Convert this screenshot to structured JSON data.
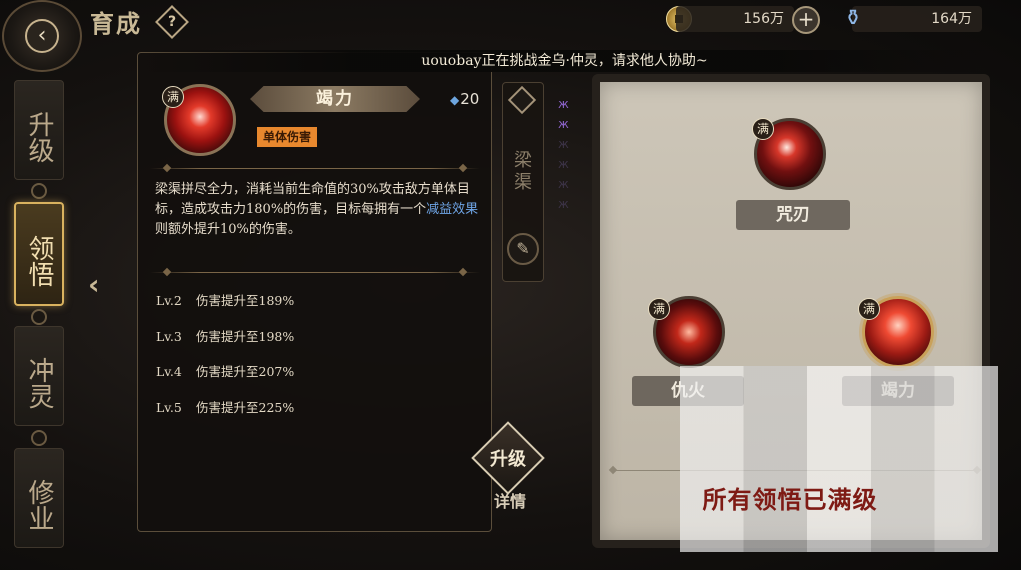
{
  "header": {
    "back_icon": "chevron-left-icon",
    "title": "育成",
    "help_icon": "question-icon",
    "coin_amount": "156万",
    "potion_amount": "164万"
  },
  "nav": {
    "items": [
      {
        "label": "升级",
        "active": false
      },
      {
        "label": "领悟",
        "active": true
      },
      {
        "label": "冲灵",
        "active": false
      },
      {
        "label": "修业",
        "active": false
      }
    ]
  },
  "banner": {
    "message": "uouobay正在挑战金乌·仲灵，请求他人协助~"
  },
  "skill": {
    "max_badge": "满",
    "name": "竭力",
    "cost": "20",
    "tag": "单体伤害",
    "description_before": "梁渠拼尽全力，消耗当前生命值的30%攻击敌方单体目标，造成攻击力180%的伤害，目标每拥有一个",
    "description_keyword": "减益效果",
    "description_after": "则额外提升10%的伤害。",
    "levels": [
      {
        "lv": "Lv.2",
        "text": "伤害提升至189%"
      },
      {
        "lv": "Lv.3",
        "text": "伤害提升至198%"
      },
      {
        "lv": "Lv.4",
        "text": "伤害提升至207%"
      },
      {
        "lv": "Lv.5",
        "text": "伤害提升至225%"
      }
    ]
  },
  "side_tab": {
    "label": "梁渠"
  },
  "buttons": {
    "upgrade": "升级",
    "detail": "详情"
  },
  "tree": {
    "nodes": [
      {
        "badge": "满",
        "label": "咒刃"
      },
      {
        "badge": "满",
        "label": "仇火"
      },
      {
        "badge": "满",
        "label": "竭力"
      }
    ],
    "status_text": "所有领悟已满级"
  },
  "colors": {
    "accent_gold": "#d9b25f",
    "tag_orange": "#e8882e",
    "keyword_blue": "#6fa5e6",
    "maxed_red": "#7e1a14"
  }
}
